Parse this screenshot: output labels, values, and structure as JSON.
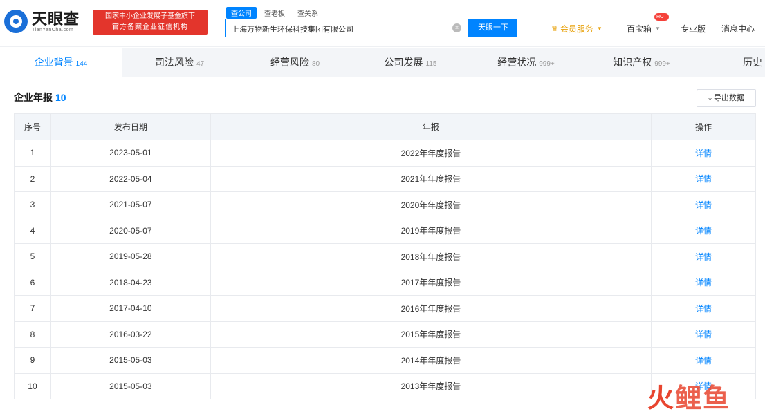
{
  "header": {
    "logo_cn": "天眼查",
    "logo_en": "TianYanCha.com",
    "gov_line1": "国家中小企业发展子基金旗下",
    "gov_line2": "官方备案企业征信机构",
    "search_tabs": [
      "查公司",
      "查老板",
      "查关系"
    ],
    "search_value": "上海万物新生环保科技集团有限公司",
    "search_button": "天眼一下",
    "vip_label": "会员服务",
    "baoxiang_label": "百宝箱",
    "hot_badge": "HOT",
    "pro_label": "专业版",
    "msg_label": "消息中心"
  },
  "tabs": [
    {
      "label": "企业背景",
      "count": "144"
    },
    {
      "label": "司法风险",
      "count": "47"
    },
    {
      "label": "经营风险",
      "count": "80"
    },
    {
      "label": "公司发展",
      "count": "115"
    },
    {
      "label": "经营状况",
      "count": "999+"
    },
    {
      "label": "知识产权",
      "count": "999+"
    },
    {
      "label": "历史",
      "count": ""
    }
  ],
  "section": {
    "title": "企业年报",
    "count": "10",
    "export_label": "导出数据"
  },
  "table": {
    "headers": [
      "序号",
      "发布日期",
      "年报",
      "操作"
    ],
    "rows": [
      {
        "no": "1",
        "date": "2023-05-01",
        "report": "2022年年度报告",
        "op": "详情"
      },
      {
        "no": "2",
        "date": "2022-05-04",
        "report": "2021年年度报告",
        "op": "详情"
      },
      {
        "no": "3",
        "date": "2021-05-07",
        "report": "2020年年度报告",
        "op": "详情"
      },
      {
        "no": "4",
        "date": "2020-05-07",
        "report": "2019年年度报告",
        "op": "详情"
      },
      {
        "no": "5",
        "date": "2019-05-28",
        "report": "2018年年度报告",
        "op": "详情"
      },
      {
        "no": "6",
        "date": "2018-04-23",
        "report": "2017年年度报告",
        "op": "详情"
      },
      {
        "no": "7",
        "date": "2017-04-10",
        "report": "2016年年度报告",
        "op": "详情"
      },
      {
        "no": "8",
        "date": "2016-03-22",
        "report": "2015年年度报告",
        "op": "详情"
      },
      {
        "no": "9",
        "date": "2015-05-03",
        "report": "2014年年度报告",
        "op": "详情"
      },
      {
        "no": "10",
        "date": "2015-05-03",
        "report": "2013年年度报告",
        "op": "详情"
      }
    ]
  },
  "watermark": {
    "fire": "火",
    "rest": "鲤鱼"
  },
  "colors": {
    "accent": "#0084ff",
    "gov_red": "#e3352c",
    "vip_gold": "#e8a20b"
  }
}
